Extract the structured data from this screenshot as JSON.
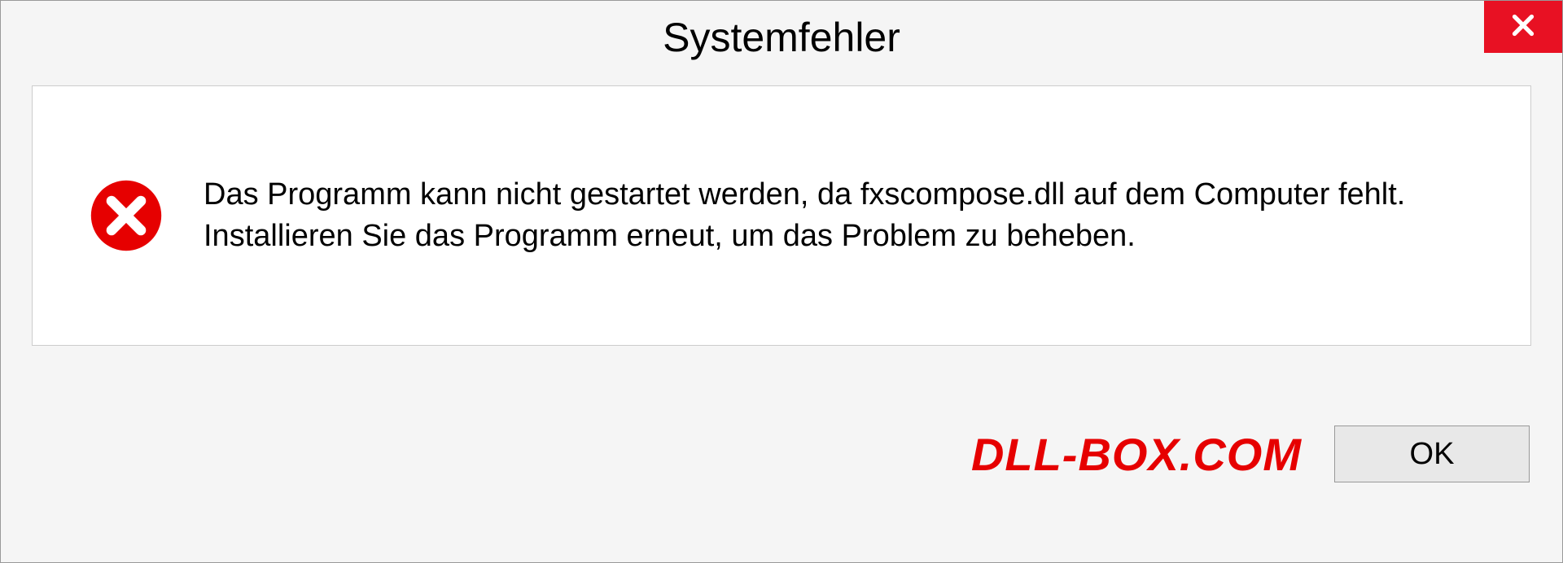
{
  "dialog": {
    "title": "Systemfehler",
    "message": "Das Programm kann nicht gestartet werden, da fxscompose.dll auf dem Computer fehlt. Installieren Sie das Programm erneut, um das Problem zu beheben.",
    "ok_label": "OK"
  },
  "watermark": "DLL-BOX.COM",
  "colors": {
    "close_bg": "#e81123",
    "error_icon": "#e60000",
    "watermark": "#e60000"
  }
}
